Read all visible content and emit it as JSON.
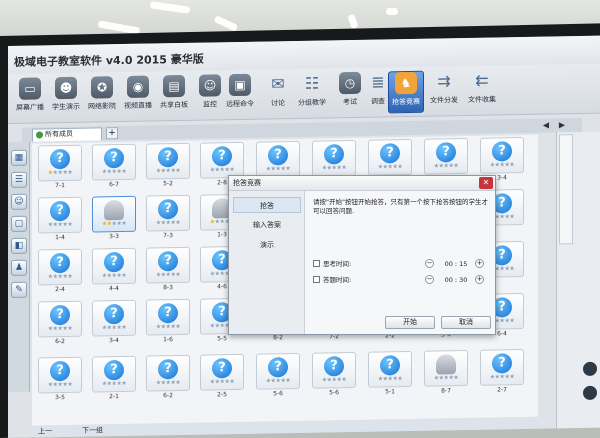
{
  "app": {
    "title": "极域电子教室软件 v4.0 2015 豪华版"
  },
  "toolbar": {
    "items": [
      {
        "label": "屏幕广播",
        "icon": "monitor-broadcast-icon"
      },
      {
        "label": "学生演示",
        "icon": "student-demo-icon"
      },
      {
        "label": "网络影院",
        "icon": "film-reel-icon"
      },
      {
        "label": "视频直播",
        "icon": "camera-icon"
      },
      {
        "label": "共享白板",
        "icon": "whiteboard-icon"
      },
      {
        "label": "监控",
        "icon": "monitor-watch-icon"
      },
      {
        "label": "远程命令",
        "icon": "remote-command-icon"
      },
      {
        "label": "讨论",
        "icon": "chat-bubble-icon"
      },
      {
        "label": "分组教学",
        "icon": "group-teaching-icon"
      },
      {
        "label": "考试",
        "icon": "exam-clock-icon"
      },
      {
        "label": "调查",
        "icon": "survey-icon"
      },
      {
        "label": "抢答竞赛",
        "icon": "quiz-competition-icon"
      },
      {
        "label": "文件分发",
        "icon": "file-send-icon"
      },
      {
        "label": "文件收集",
        "icon": "file-collect-icon"
      }
    ]
  },
  "tabs": {
    "active": "所有成员",
    "add": "+"
  },
  "students": [
    {
      "seat": "7-1",
      "avatar": "?",
      "stars": 1,
      "kind": "question"
    },
    {
      "seat": "6-7",
      "avatar": "?",
      "stars": 0,
      "kind": "question"
    },
    {
      "seat": "5-2",
      "avatar": "?",
      "stars": 0,
      "kind": "question"
    },
    {
      "seat": "2-8",
      "avatar": "?",
      "stars": 0,
      "kind": "question"
    },
    {
      "seat": "",
      "avatar": "?",
      "stars": 0,
      "kind": "question"
    },
    {
      "seat": "",
      "avatar": "?",
      "stars": 0,
      "kind": "question"
    },
    {
      "seat": "",
      "avatar": "?",
      "stars": 0,
      "kind": "question"
    },
    {
      "seat": "",
      "avatar": "?",
      "stars": 0,
      "kind": "question"
    },
    {
      "seat": "3-4",
      "avatar": "?",
      "stars": 0,
      "kind": "question"
    },
    {
      "seat": "1-4",
      "avatar": "?",
      "stars": 0,
      "kind": "question"
    },
    {
      "seat": "3-3",
      "avatar": "",
      "stars": 2,
      "kind": "person"
    },
    {
      "seat": "7-3",
      "avatar": "?",
      "stars": 0,
      "kind": "question"
    },
    {
      "seat": "1-3",
      "avatar": "",
      "stars": 1,
      "kind": "person"
    },
    {
      "seat": "",
      "avatar": "?",
      "stars": 0,
      "kind": "question"
    },
    {
      "seat": "2-4",
      "avatar": "?",
      "stars": 0,
      "kind": "question"
    },
    {
      "seat": "4-4",
      "avatar": "?",
      "stars": 0,
      "kind": "question"
    },
    {
      "seat": "8-3",
      "avatar": "?",
      "stars": 0,
      "kind": "question"
    },
    {
      "seat": "4-6",
      "avatar": "?",
      "stars": 0,
      "kind": "question"
    },
    {
      "seat": "",
      "avatar": "?",
      "stars": 0,
      "kind": "question"
    },
    {
      "seat": "6-2",
      "avatar": "?",
      "stars": 0,
      "kind": "question"
    },
    {
      "seat": "3-4",
      "avatar": "?",
      "stars": 0,
      "kind": "question"
    },
    {
      "seat": "1-6",
      "avatar": "?",
      "stars": 0,
      "kind": "question"
    },
    {
      "seat": "5-5",
      "avatar": "?",
      "stars": 0,
      "kind": "question"
    },
    {
      "seat": "8-2",
      "avatar": "?",
      "stars": 0,
      "kind": "question"
    },
    {
      "seat": "7-2",
      "avatar": "?",
      "stars": 0,
      "kind": "question"
    },
    {
      "seat": "2-2",
      "avatar": "?",
      "stars": 0,
      "kind": "question"
    },
    {
      "seat": "5-4",
      "avatar": "?",
      "stars": 0,
      "kind": "question"
    },
    {
      "seat": "6-4",
      "avatar": "?",
      "stars": 0,
      "kind": "question"
    },
    {
      "seat": "3-5",
      "avatar": "?",
      "stars": 0,
      "kind": "question"
    },
    {
      "seat": "2-1",
      "avatar": "?",
      "stars": 0,
      "kind": "question"
    },
    {
      "seat": "6-2",
      "avatar": "?",
      "stars": 0,
      "kind": "question"
    },
    {
      "seat": "2-5",
      "avatar": "?",
      "stars": 0,
      "kind": "question"
    },
    {
      "seat": "5-6",
      "avatar": "?",
      "stars": 0,
      "kind": "question"
    },
    {
      "seat": "5-6",
      "avatar": "?",
      "stars": 0,
      "kind": "question"
    },
    {
      "seat": "5-1",
      "avatar": "?",
      "stars": 0,
      "kind": "question"
    },
    {
      "seat": "8-7",
      "avatar": "",
      "stars": 0,
      "kind": "person"
    },
    {
      "seat": "2-7",
      "avatar": "?",
      "stars": 0,
      "kind": "question"
    }
  ],
  "statusbar": {
    "prev": "上一",
    "next": "下一组"
  },
  "right_panel": {
    "tab_label": ""
  },
  "dialog": {
    "title": "抢答竞赛",
    "nav": [
      "抢答",
      "输入答案",
      "演示"
    ],
    "description": "请按\"开始\"按钮开始抢答，只有第一个按下抢答按钮的学生才可以回答问题.",
    "options": [
      {
        "label": "思考时间:",
        "value": "00 : 15",
        "checked": false
      },
      {
        "label": "答题时间:",
        "value": "00 : 30",
        "checked": false
      }
    ],
    "start_label": "开始",
    "cancel_label": "取消"
  },
  "colors": {
    "accent": "#2e64b4",
    "close": "#c8323b",
    "star": "#e8b21e"
  }
}
